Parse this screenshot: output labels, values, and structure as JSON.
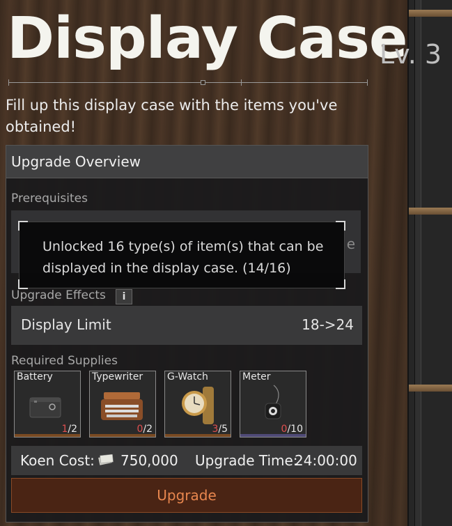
{
  "header": {
    "title": "Display Case",
    "level": "Lv. 3"
  },
  "description": "Fill up this display case with the items you've obtained!",
  "panel": {
    "title": "Upgrade Overview",
    "prerequisites_label": "Prerequisites",
    "effects_label": "Upgrade Effects",
    "info_icon_glyph": "i",
    "effect": {
      "label": "Display Limit",
      "value": "18->24"
    },
    "supplies_label": "Required Supplies",
    "supplies": [
      {
        "name": "Battery",
        "have": "1",
        "need": "/2",
        "icon": "battery-icon"
      },
      {
        "name": "Typewriter",
        "have": "0",
        "need": "/2",
        "icon": "typewriter-icon"
      },
      {
        "name": "G-Watch",
        "have": "3",
        "need": "/5",
        "icon": "watch-icon"
      },
      {
        "name": "Meter",
        "have": "0",
        "need": "/10",
        "icon": "meter-icon"
      }
    ],
    "cost_label": "Koen Cost:",
    "cost_value": "750,000",
    "time_label": "Upgrade Time:",
    "time_value": "24:00:00",
    "upgrade_button": "Upgrade"
  },
  "tooltip": {
    "text": "Unlocked 16 type(s) of item(s) that can be displayed in the display case. (14/16)"
  },
  "colors": {
    "accent_orange": "#e8864e",
    "shortfall_red": "#e05050",
    "button_bg": "#4a2414"
  }
}
